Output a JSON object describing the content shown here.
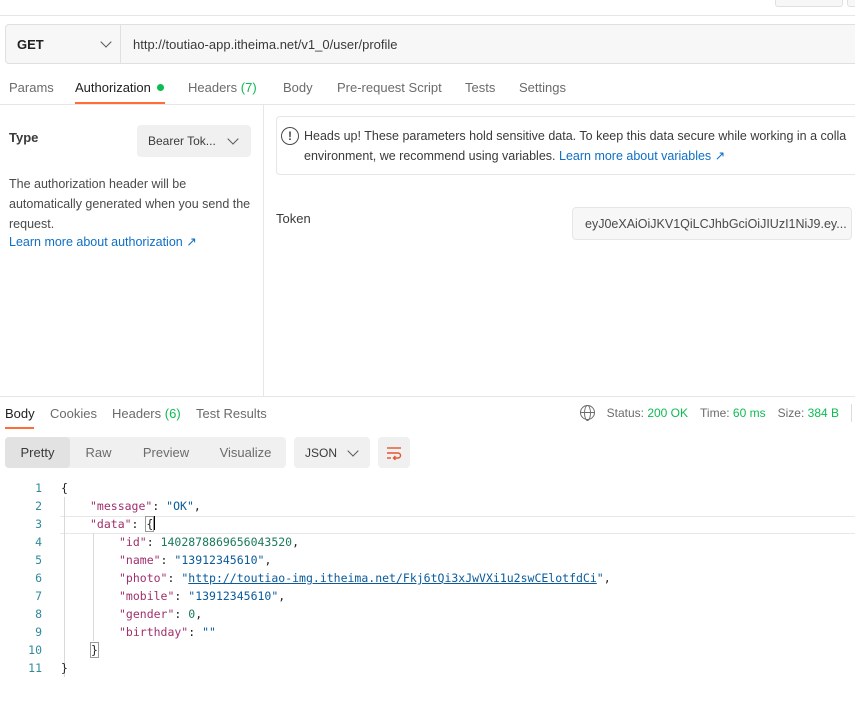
{
  "request": {
    "method": "GET",
    "url": "http://toutiao-app.itheima.net/v1_0/user/profile"
  },
  "request_tabs": [
    {
      "label": "Params"
    },
    {
      "label": "Authorization"
    },
    {
      "label": "Headers",
      "count": "(7)"
    },
    {
      "label": "Body"
    },
    {
      "label": "Pre-request Script"
    },
    {
      "label": "Tests"
    },
    {
      "label": "Settings"
    }
  ],
  "auth": {
    "type_label": "Type",
    "type_value": "Bearer Tok...",
    "description": "The authorization header will be automatically generated when you send the request.",
    "learn_link": "Learn more about authorization ↗",
    "warning_text_1": "Heads up! These parameters hold sensitive data. To keep this data secure while working in a colla",
    "warning_text_2": "environment, we recommend using variables.",
    "warning_link": "Learn more about variables ↗",
    "token_label": "Token",
    "token_value": "eyJ0eXAiOiJKV1QiLCJhbGciOiJIUzI1NiJ9.ey..."
  },
  "response_tabs": [
    {
      "label": "Body"
    },
    {
      "label": "Cookies"
    },
    {
      "label": "Headers",
      "count": "(6)"
    },
    {
      "label": "Test Results"
    }
  ],
  "status": {
    "status_label": "Status:",
    "status_value": "200 OK",
    "time_label": "Time:",
    "time_value": "60 ms",
    "size_label": "Size:",
    "size_value": "384 B"
  },
  "view_modes": [
    "Pretty",
    "Raw",
    "Preview",
    "Visualize"
  ],
  "format": "JSON",
  "code_lines": [
    {
      "n": "1"
    },
    {
      "n": "2"
    },
    {
      "n": "3"
    },
    {
      "n": "4"
    },
    {
      "n": "5"
    },
    {
      "n": "6"
    },
    {
      "n": "7"
    },
    {
      "n": "8"
    },
    {
      "n": "9"
    },
    {
      "n": "10"
    },
    {
      "n": "11"
    }
  ],
  "response_json": {
    "message": "OK",
    "data": {
      "id": "1402878869656043520",
      "name": "13912345610",
      "photo": "http://toutiao-img.itheima.net/Fkj6tQi3xJwVXi1u2swCElotfdCi",
      "mobile": "13912345610",
      "gender": "0",
      "birthday": ""
    }
  },
  "colors": {
    "accent_tab": "#ff6c37",
    "success": "#0cbb52",
    "link": "#0f6fc5"
  }
}
